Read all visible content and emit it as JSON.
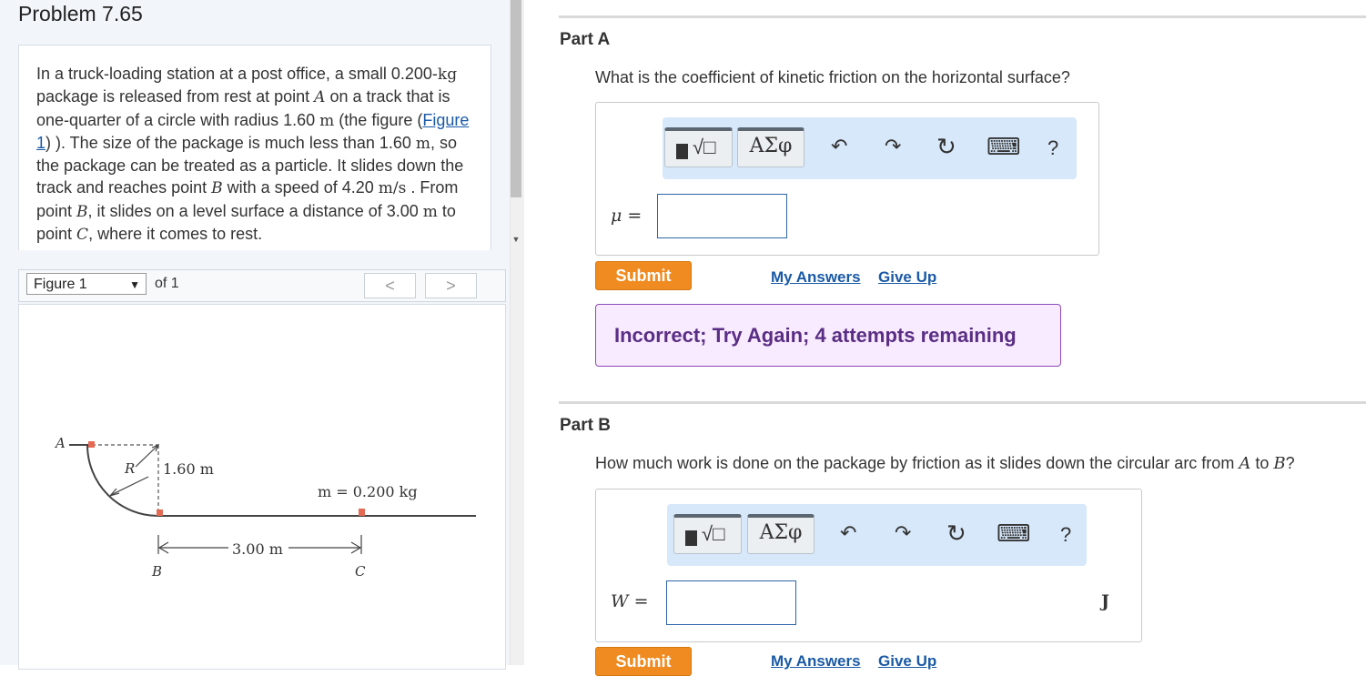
{
  "problem": {
    "title": "Problem 7.65",
    "text": {
      "s1": "In a truck-loading station at a post office, a small 0.200-",
      "unit_kg": "kg",
      "s2": " package is released from rest at point ",
      "pt_a": "A",
      "s3": " on a track that is one-quarter of a circle with radius 1.60 ",
      "unit_m1": "m",
      "s4": " (the figure (",
      "figure_link": "Figure 1",
      "s5": ") ). The size of the package is much less than 1.60 ",
      "unit_m2": "m",
      "s6": ", so the package can be treated as a particle. It slides down the track and reaches point ",
      "pt_b": "B",
      "s7": " with a speed of 4.20 ",
      "unit_ms": "m/s",
      "s8": " . From point ",
      "pt_b2": "B",
      "s9": ", it slides on a level surface a distance of 3.00 ",
      "unit_m3": "m",
      "s10": " to point ",
      "pt_c": "C",
      "s11": ", where it comes to rest."
    }
  },
  "figure_nav": {
    "select_value": "Figure 1",
    "dropdown_arrow": "▼",
    "of_label": "of 1",
    "prev_label": "<",
    "next_label": ">"
  },
  "figure": {
    "label_a": "A",
    "label_r": "R",
    "label_radius": "1.60 m",
    "label_mass": "m = 0.200 kg",
    "label_distance": "3.00 m",
    "label_b": "B",
    "label_c": "C",
    "package_color": "#e46a54"
  },
  "parts": [
    {
      "title": "Part A",
      "question": "What is the coefficient of kinetic friction on the horizontal surface?",
      "toolbar": {
        "templates_label": "√□",
        "greek_label": "ΑΣφ",
        "undo_icon": "↶",
        "redo_icon": "↷",
        "reset_icon": "↻",
        "keyboard_icon": "⌨",
        "help_label": "?"
      },
      "answer_label": "μ =",
      "answer_value": "",
      "submit_label": "Submit",
      "my_answers_label": "My Answers",
      "give_up_label": "Give Up",
      "feedback": "Incorrect; Try Again; 4 attempts remaining"
    },
    {
      "title": "Part B",
      "question_pre": "How much work is done on the package by friction as it slides down the circular arc from ",
      "pt_a": "A",
      "question_mid": " to ",
      "pt_b": "B",
      "question_post": "?",
      "toolbar": {
        "templates_label": "√□",
        "greek_label": "ΑΣφ",
        "undo_icon": "↶",
        "redo_icon": "↷",
        "reset_icon": "↻",
        "keyboard_icon": "⌨",
        "help_label": "?"
      },
      "answer_label": "W =",
      "answer_value": "",
      "unit": "J",
      "submit_label": "Submit",
      "my_answers_label": "My Answers",
      "give_up_label": "Give Up"
    }
  ],
  "colors": {
    "submit": "#ef8b20",
    "link": "#1a5aa6",
    "feedback_bg": "#f8eaff",
    "feedback_text": "#5a2e84",
    "toolbar_bg": "#d7e8fa"
  }
}
